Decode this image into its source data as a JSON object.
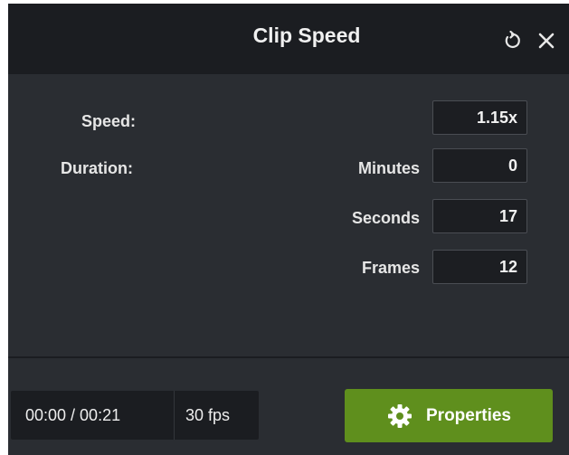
{
  "header": {
    "title": "Clip Speed",
    "reset_icon": "reset-icon",
    "close_icon": "close-icon"
  },
  "fields": {
    "speed_label": "Speed:",
    "speed_value": "1.15x",
    "duration_label": "Duration:",
    "minutes_label": "Minutes",
    "minutes_value": "0",
    "seconds_label": "Seconds",
    "seconds_value": "17",
    "frames_label": "Frames",
    "frames_value": "12"
  },
  "footer": {
    "timecode": "00:00 / 00:21",
    "fps": "30 fps",
    "properties_label": "Properties",
    "properties_icon": "gear-icon"
  },
  "colors": {
    "panel_bg": "#2a2d32",
    "header_bg": "#1b1d21",
    "accent_green": "#5f8f1d"
  }
}
